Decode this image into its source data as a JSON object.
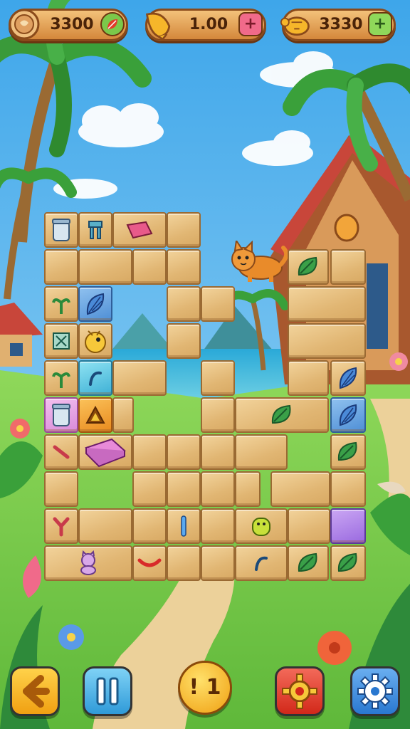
{
  "hud": {
    "coins": "3300",
    "energy": "1.00",
    "gems": "3330",
    "coins_icon": "coin-icon",
    "energy_icon": "horn-icon",
    "gems_icon": "turtle-icon"
  },
  "center_button": {
    "label": "! 1"
  },
  "colors": {
    "sky": "#56b6ee",
    "grass": "#7cd04a",
    "wood": "#e1b673",
    "wood_border": "#9a6a33",
    "hud_bg": "#e0a050",
    "back_button": "#f5b21a",
    "pause_button": "#3aa7e0",
    "hint_button": "#f7b51a",
    "gear_red_button": "#e23a2a",
    "settings_button": "#2f86d8"
  },
  "controls": {
    "back_icon": "back-arrow-icon",
    "pause_icon": "pause-icon",
    "hint_icon": "hint-coin-icon",
    "shuffle_icon": "red-gear-icon",
    "settings_icon": "settings-gear-icon"
  }
}
